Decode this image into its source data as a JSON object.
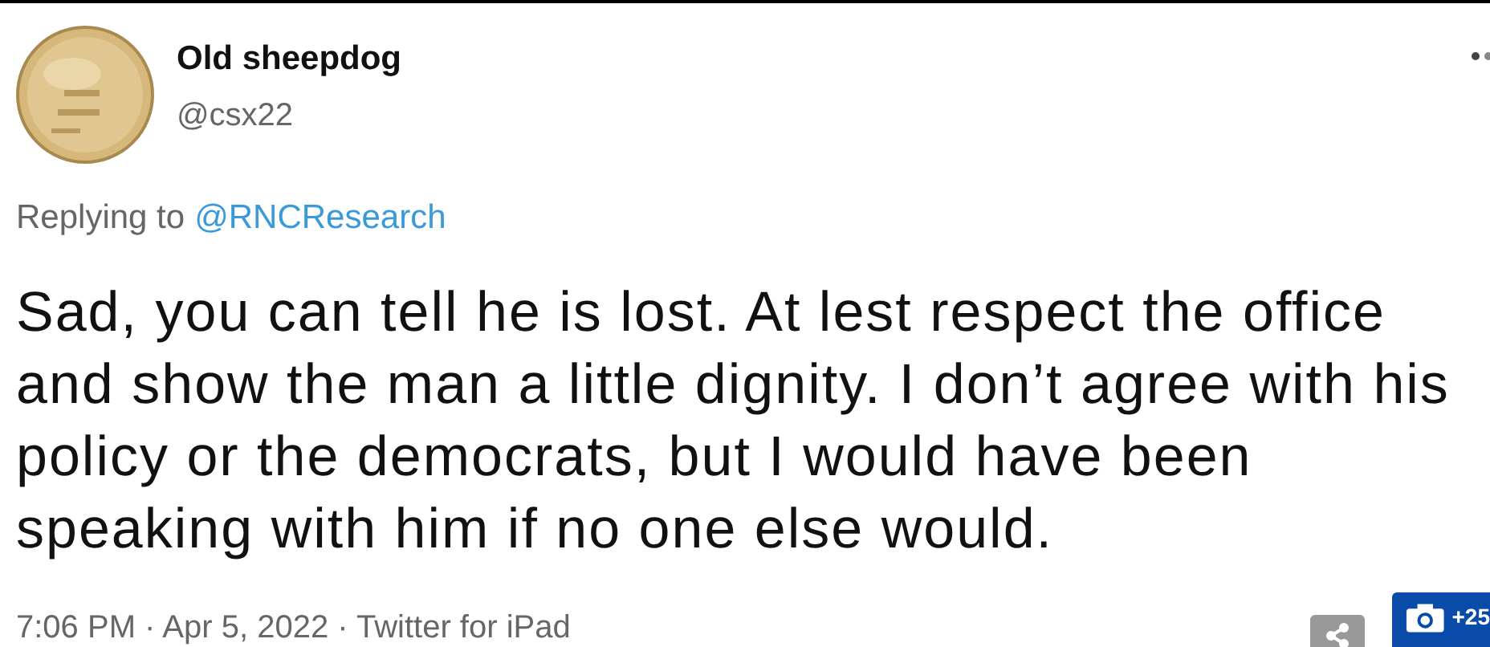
{
  "author": {
    "name": "Old sheepdog",
    "handle": "@csx22"
  },
  "reply": {
    "prefix": "Replying to",
    "mention": "@RNCResearch"
  },
  "body": "Sad, you can tell he is lost. At lest respect the office and show the man a little dignity. I don’t agree with his policy or the democrats, but I would have been speaking with him if no one else would.",
  "meta": "7:06 PM · Apr 5, 2022 · Twitter for iPad",
  "gallery_badge": "+25"
}
